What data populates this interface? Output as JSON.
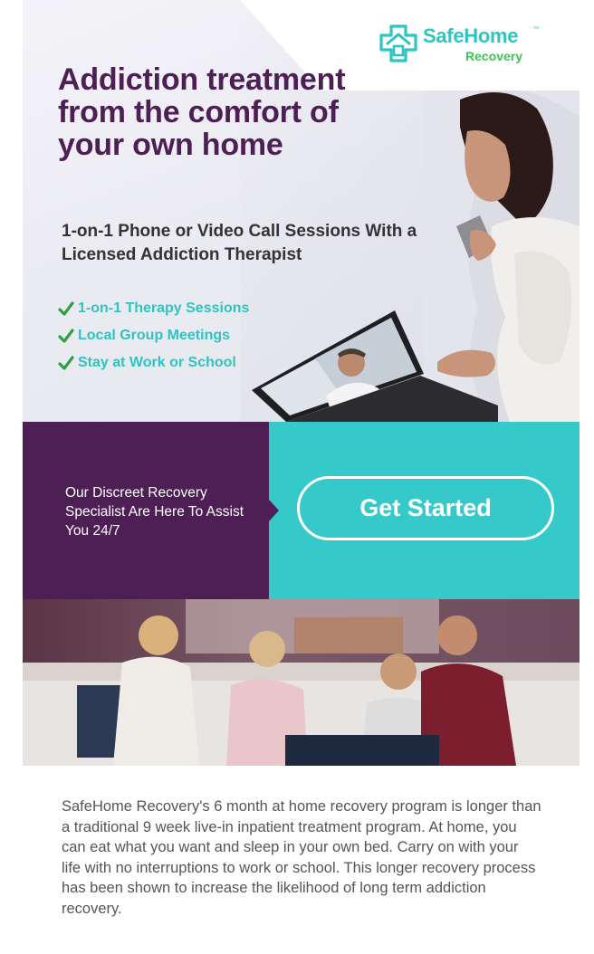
{
  "brand": {
    "name": "SafeHome",
    "trademark": "™",
    "subtitle": "Recovery",
    "icon": "house-cross-logo-icon",
    "colors": {
      "teal": "#2ec4c1",
      "green": "#44c057",
      "purple": "#4d1f54",
      "band_teal": "#35c9c9"
    }
  },
  "hero": {
    "headline": "Addiction treatment from the comfort of your own home",
    "subheadline": "1-on-1 Phone or Video Call Sessions With a Licensed Addiction Therapist",
    "bullets": [
      {
        "icon": "checkmark-icon",
        "label": "1-on-1 Therapy Sessions"
      },
      {
        "icon": "checkmark-icon",
        "label": "Local Group Meetings"
      },
      {
        "icon": "checkmark-icon",
        "label": "Stay at Work or School"
      }
    ]
  },
  "cta": {
    "message": "Our Discreet Recovery Specialist Are Here To Assist You 24/7",
    "button_label": "Get Started"
  },
  "body": {
    "paragraph": "SafeHome Recovery's 6 month at home recovery program is longer than a traditional 9 week live-in inpatient treatment program. At home, you can eat what you want and sleep in your own bed. Carry on with your life with no interruptions to work or school. This longer recovery process has been shown to increase the likelihood of long term addiction recovery."
  }
}
